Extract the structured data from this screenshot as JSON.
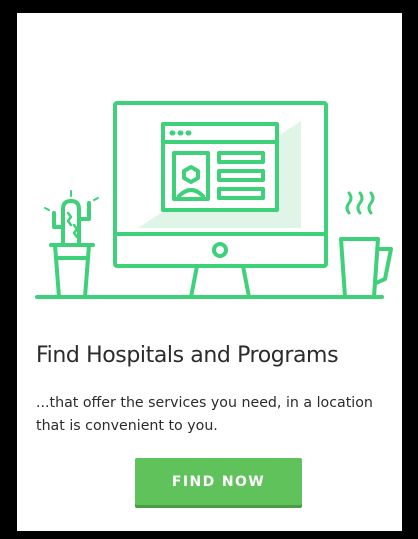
{
  "card": {
    "title": "Find Hospitals and Programs",
    "description": "...that offer the services you need, in a location that is convenient to you.",
    "button_label": "FIND NOW"
  },
  "colors": {
    "accent": "#3ed17a",
    "button": "#5fc25a",
    "text": "#2b2b2b"
  },
  "icons": [
    "cactus-icon",
    "computer-monitor-icon",
    "profile-card-icon",
    "coffee-mug-icon"
  ]
}
